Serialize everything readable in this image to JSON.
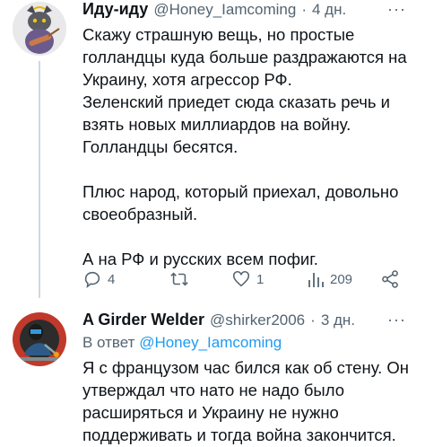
{
  "tweet1": {
    "display_name": "Иду-иду",
    "handle": "@Honey_Iamcoming",
    "separator": "·",
    "time": "4 дн.",
    "more": "···",
    "text": "Скажу страшную вещь, но простые\nголландцы куда больше раздражаются на\nУкраину, хотя агрессор РФ.\nЗеленский приедет сюда сказать речь и\nвзять новых миллиардов на войну.\nГолландцы бесятся.\n\nПлюс народ, который приехал, довольно\nсвоеобразный.\n\nА на РФ и русских всем пофиг.",
    "stats": {
      "replies": "4",
      "retweets": "",
      "likes": "1",
      "views": "209"
    }
  },
  "tweet2": {
    "display_name": "A Girder Welder",
    "handle": "@shirker2006",
    "separator": "·",
    "time": "3 дн.",
    "more": "···",
    "reply_prefix": "В ответ",
    "reply_to": "@Honey_Iamcoming",
    "text": "Я с французом час бился как об стену. Он\nутверждал что нато не надо было\nрасширяться и Украину не нужно\nподдерживать и тогда война закончится."
  },
  "colors": {
    "accent": "#1d9bf0",
    "muted": "#536471",
    "text": "#0f1419"
  }
}
